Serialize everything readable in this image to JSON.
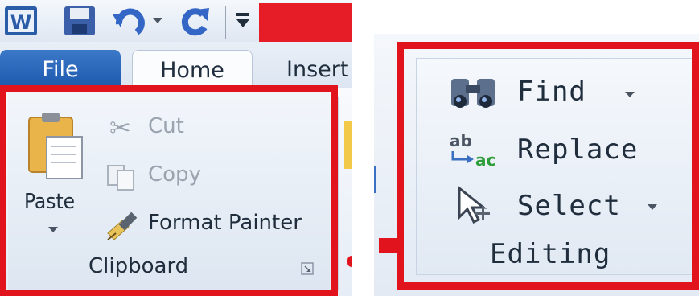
{
  "quick_access": {
    "word_logo": "W",
    "icons": [
      "word-logo-icon",
      "save-icon",
      "undo-icon",
      "dropdown-icon",
      "redo-icon",
      "customize-qat-icon"
    ]
  },
  "tabs": {
    "file": "File",
    "home": "Home",
    "insert": "Insert"
  },
  "clipboard": {
    "paste_label": "Paste",
    "cut_label": "Cut",
    "copy_label": "Copy",
    "format_painter_label": "Format Painter",
    "group_label": "Clipboard"
  },
  "editing": {
    "find_label": "Find",
    "replace_label": "Replace",
    "select_label": "Select",
    "group_label": "Editing"
  },
  "colors": {
    "highlight_frame": "#e1141d",
    "file_tab": "#1c58ad",
    "ribbon_bg": "#e6edf6"
  }
}
